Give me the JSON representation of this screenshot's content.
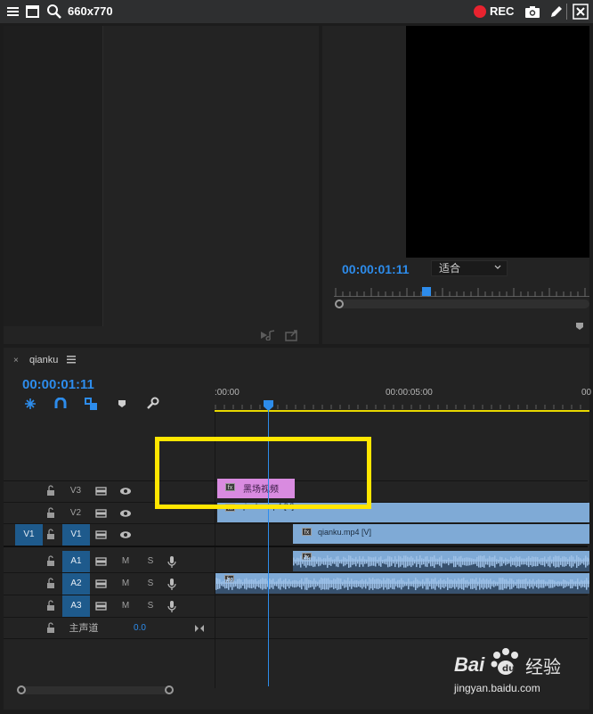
{
  "recorder": {
    "size_label": "660x770",
    "rec_label": "REC"
  },
  "program_monitor": {
    "timecode": "00:00:01:11",
    "fit_select": "适合"
  },
  "timeline": {
    "tab_label": "qianku",
    "timecode": "00:00:01:11",
    "ruler_labels": [
      ":00:00",
      "00:00:05:00",
      "00"
    ],
    "tracks": {
      "v3": "V3",
      "v2": "V2",
      "v1": "V1",
      "v1_source": "V1",
      "a1": "A1",
      "a2": "A2",
      "a3": "A3",
      "mute": "M",
      "solo": "S",
      "master_label": "主声道",
      "master_value": "0.0"
    },
    "clips": {
      "black_video": "黑场视频",
      "v2_clip": "qianku.mp4 [V]",
      "v1_clip": "qianku.mp4 [V]",
      "fx": "fx"
    }
  },
  "watermark": {
    "brand": "Bai",
    "brand2": "经验",
    "url": "jingyan.baidu.com"
  },
  "colors": {
    "accent_blue": "#2d8ceb",
    "clip_blue": "#7faad6",
    "clip_pink": "#d98be0",
    "highlight_yellow": "#ffe600",
    "rec_red": "#e8232f"
  }
}
